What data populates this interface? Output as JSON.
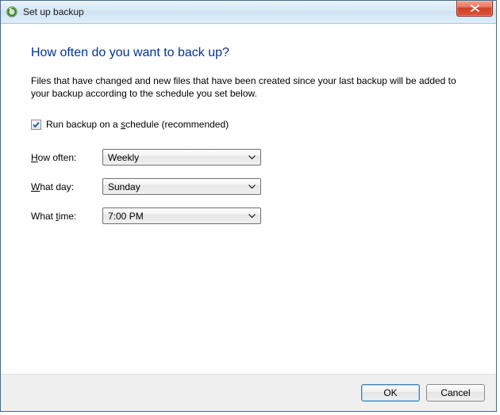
{
  "window": {
    "title": "Set up backup"
  },
  "heading": "How often do you want to back up?",
  "description": "Files that have changed and new files that have been created since your last backup will be added to your backup according to the schedule you set below.",
  "schedule_checkbox": {
    "checked": true,
    "label_before_s": "Run backup on a ",
    "label_s": "s",
    "label_after_s": "chedule (recommended)"
  },
  "fields": {
    "how_often": {
      "label_H": "H",
      "label_rest": "ow often:",
      "value": "Weekly"
    },
    "what_day": {
      "label_W": "W",
      "label_rest": "hat day:",
      "value": "Sunday"
    },
    "what_time": {
      "label_before_t": "What ",
      "label_t": "t",
      "label_after_t": "ime:",
      "value": "7:00 PM"
    }
  },
  "buttons": {
    "ok": "OK",
    "cancel": "Cancel"
  }
}
